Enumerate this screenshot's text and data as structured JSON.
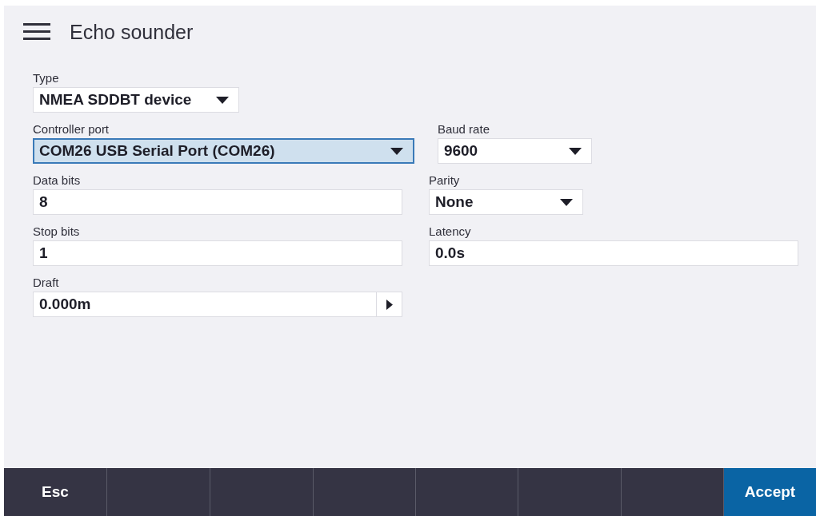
{
  "header": {
    "title": "Echo sounder"
  },
  "rows": [
    {
      "left": {
        "kind": "dropdown",
        "label": "Type",
        "value": "NMEA SDDBT device",
        "focused": false
      },
      "right": null
    },
    {
      "left": {
        "kind": "dropdown",
        "label": "Controller port",
        "value": "COM26 USB Serial Port (COM26)",
        "focused": true
      },
      "right": {
        "kind": "dropdown",
        "label": "Baud rate",
        "value": "9600",
        "focused": false
      }
    },
    {
      "left": {
        "kind": "text",
        "label": "Data bits",
        "value": "8",
        "focused": false
      },
      "right": {
        "kind": "dropdown",
        "label": "Parity",
        "value": "None",
        "focused": false
      }
    },
    {
      "left": {
        "kind": "text",
        "label": "Stop bits",
        "value": "1",
        "focused": false
      },
      "right": {
        "kind": "text",
        "label": "Latency",
        "value": "0.0s",
        "focused": false
      }
    },
    {
      "left": {
        "kind": "stepper",
        "label": "Draft",
        "value": "0.000m",
        "focused": false
      },
      "right": null
    }
  ],
  "footer": {
    "keys": [
      {
        "label": "Esc",
        "kind": "plain"
      },
      {
        "kind": "blank"
      },
      {
        "kind": "blank"
      },
      {
        "kind": "blank"
      },
      {
        "kind": "blank"
      },
      {
        "kind": "blank"
      },
      {
        "kind": "blank"
      },
      {
        "label": "Accept",
        "kind": "primary"
      }
    ]
  }
}
